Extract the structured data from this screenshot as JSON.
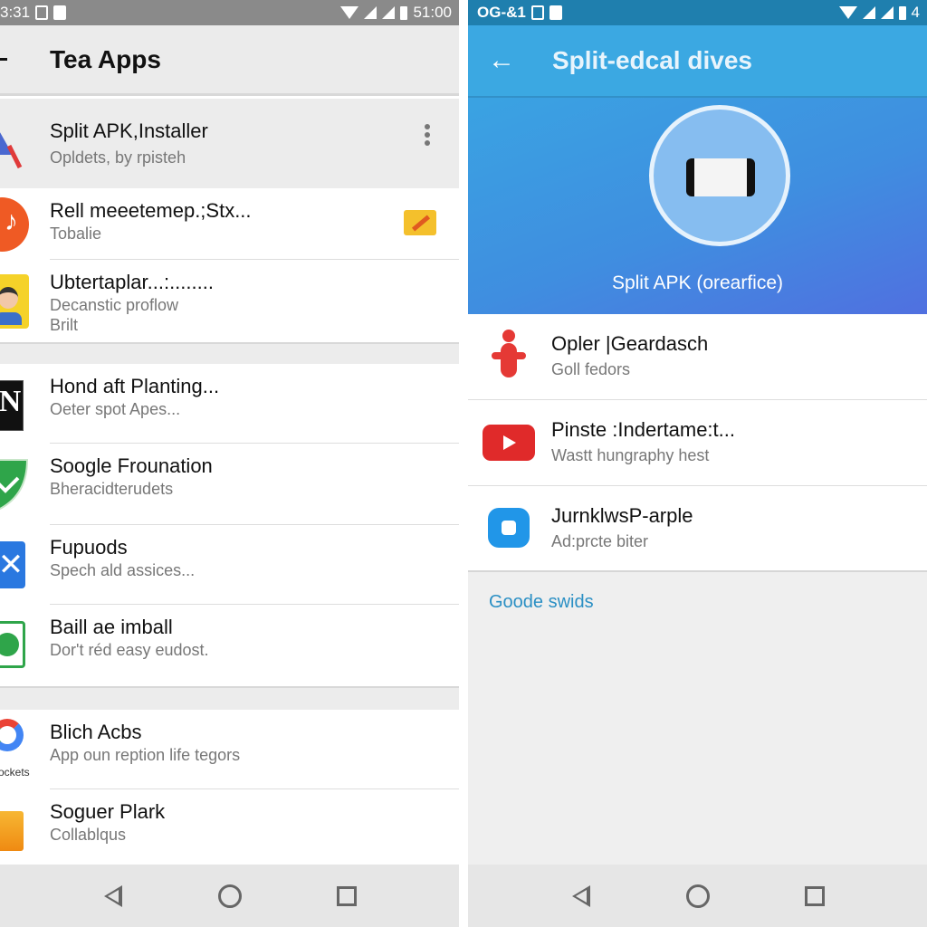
{
  "left": {
    "status": {
      "left_text": "3:31",
      "time": "51:00"
    },
    "header": {
      "back_icon": "arrow-left-icon",
      "title": "Tea Apps"
    },
    "items": [
      {
        "title": "Split APK,Installer",
        "subtitle": "Opldets, by rpisteh",
        "icon": "split-apk-icon",
        "action": "more-vert-icon"
      },
      {
        "title": "Rell meeetemep.;Stx...",
        "subtitle": "Tobalie",
        "icon": "music-icon",
        "action": "folder-edit-icon"
      },
      {
        "title": "Ubtertaplar...:........",
        "subtitle": "Decanstic proflow",
        "subtitle2": "Brilt",
        "icon": "avatar-icon"
      },
      {
        "title": "Hond aft Planting...",
        "subtitle": "Oeter spot Apes...",
        "icon": "n-logo-icon"
      },
      {
        "title": "Soogle Frounation",
        "subtitle": "Bheracidterudets",
        "icon": "shield-icon"
      },
      {
        "title": "Fupuods",
        "subtitle": "Spech ald assices...",
        "icon": "blue-x-icon"
      },
      {
        "title": "Baill ae imball",
        "subtitle": "Dor't réd easy eudost.",
        "icon": "whatsapp-icon"
      },
      {
        "title": "Blich Acbs",
        "subtitle": "App oun reption life tegors",
        "icon": "google-icon",
        "icon_caption": "ockets"
      },
      {
        "title": "Soguer Plark",
        "subtitle": "Collablqus",
        "icon": "box-icon"
      }
    ]
  },
  "right": {
    "status": {
      "left_text": "OG-&1",
      "time": "4"
    },
    "header": {
      "back_icon": "arrow-left-icon",
      "title": "Split-edcal dives"
    },
    "hero": {
      "icon": "storage-icon",
      "caption": "Split APK (orearfice)"
    },
    "items": [
      {
        "title": "Opler |Geardasch",
        "subtitle": "Goll fedors",
        "icon": "red-figure-icon"
      },
      {
        "title": "Pinste :Indertame:t...",
        "subtitle": "Wastt hungraphy hest",
        "icon": "youtube-icon"
      },
      {
        "title": "JurnklwsP-arple",
        "subtitle": "Ad:prcte biter",
        "icon": "lock-bag-icon"
      }
    ],
    "section_link": "Goode swids"
  },
  "colors": {
    "accent": "#3ba8e2",
    "link": "#2a8fc4"
  }
}
